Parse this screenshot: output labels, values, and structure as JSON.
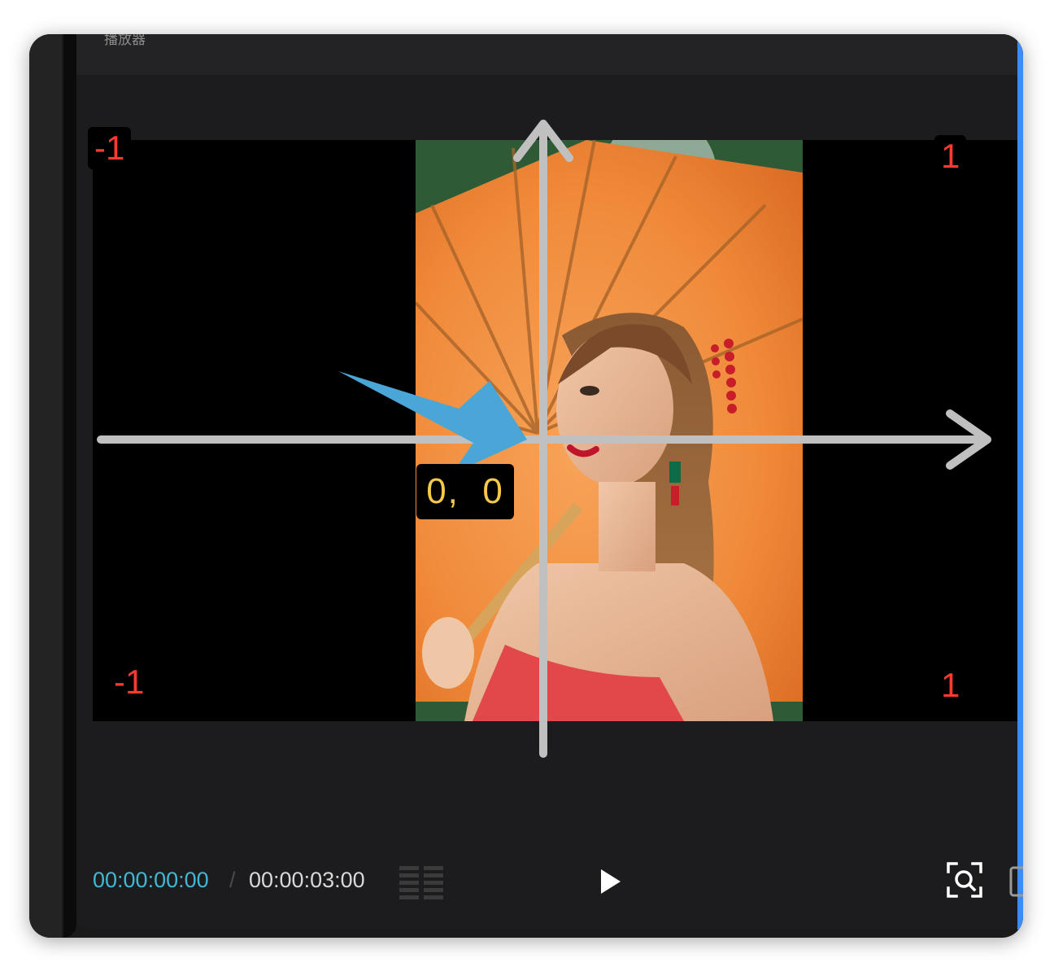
{
  "panel": {
    "title": "播放器"
  },
  "viewer": {
    "corner_labels": {
      "top_left": "-1",
      "top_right": "1",
      "bottom_left": "-1",
      "bottom_right": "1"
    },
    "origin_label": "0,  0",
    "colors": {
      "corner_label": "#ff3b30",
      "origin_label": "#f7c948",
      "axis": "#c0c0c0",
      "pointer_arrow": "#4aa6d6"
    }
  },
  "player": {
    "current_time": "00:00:00:00",
    "separator": "/",
    "total_time": "00:00:03:00",
    "icons": {
      "view_mode": "grid-bars-icon",
      "play": "play-icon",
      "zoom": "zoom-fit-icon"
    },
    "colors": {
      "current_time": "#3fb8d4",
      "total_time": "#d8d8d8",
      "accent_edge": "#3d8bf5"
    }
  }
}
